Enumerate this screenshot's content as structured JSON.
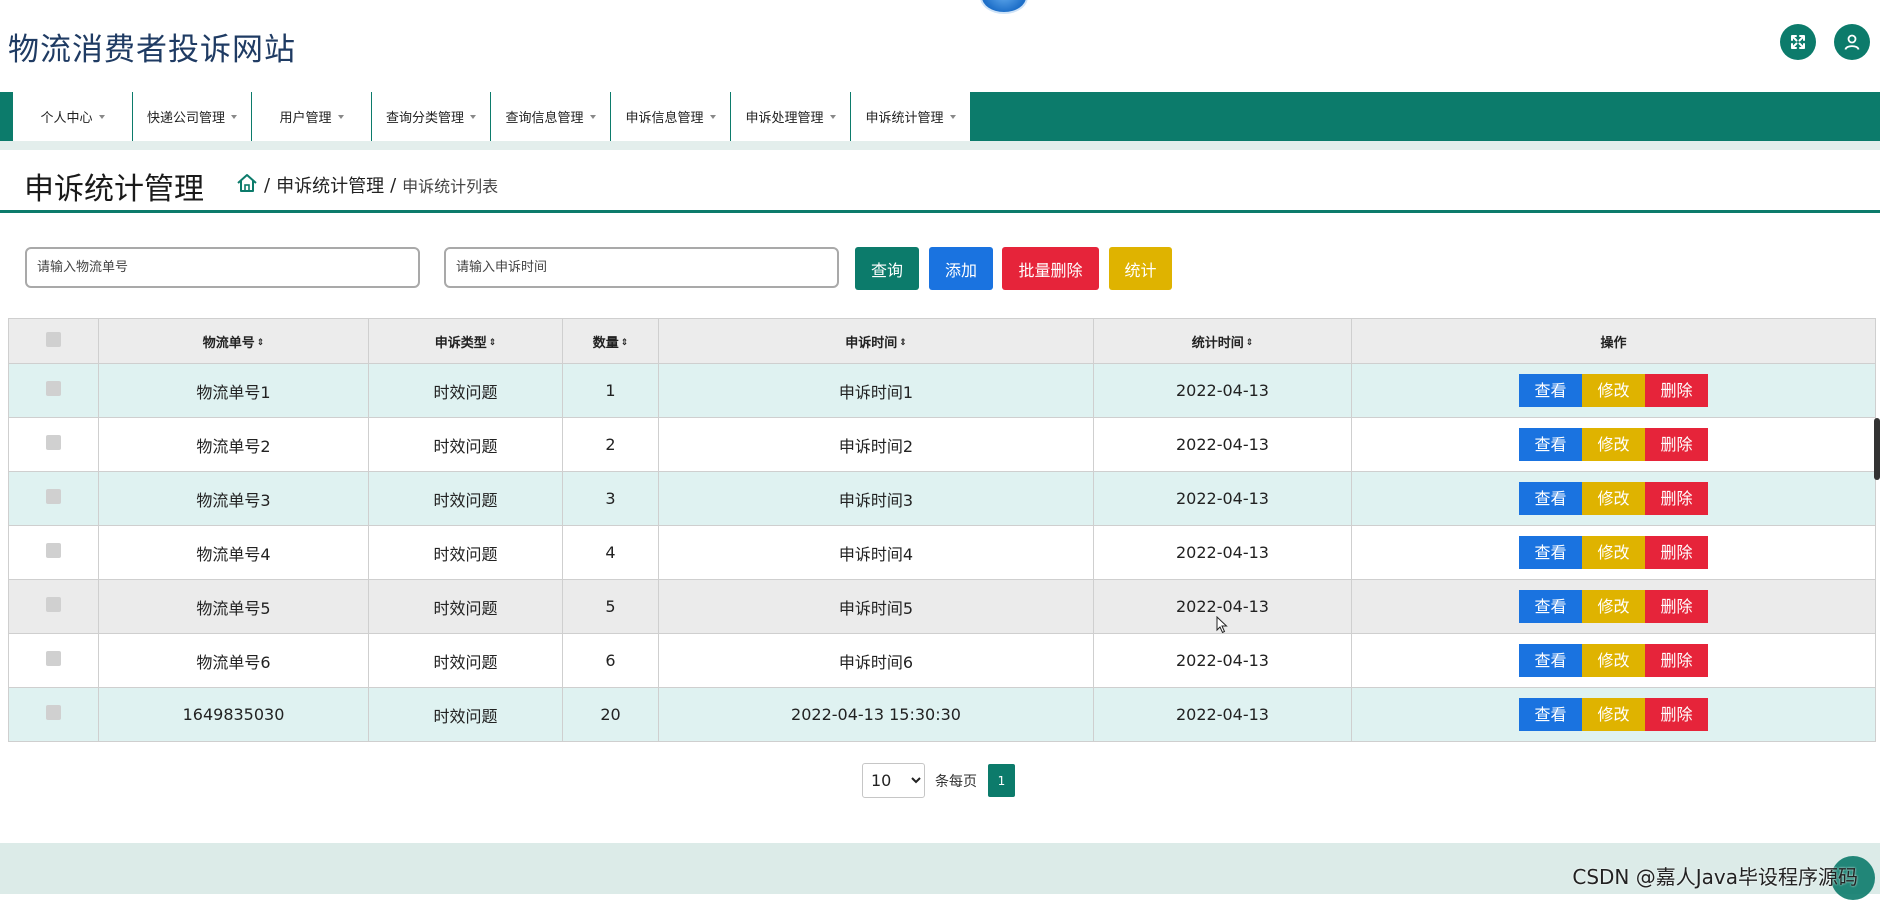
{
  "header": {
    "site_title": "物流消费者投诉网站"
  },
  "nav": {
    "items": [
      {
        "label": "个人中心"
      },
      {
        "label": "快递公司管理"
      },
      {
        "label": "用户管理"
      },
      {
        "label": "查询分类管理"
      },
      {
        "label": "查询信息管理"
      },
      {
        "label": "申诉信息管理"
      },
      {
        "label": "申诉处理管理"
      },
      {
        "label": "申诉统计管理"
      }
    ]
  },
  "page": {
    "title": "申诉统计管理",
    "breadcrumb": [
      "申诉统计管理",
      "申诉统计列表"
    ],
    "separator": "/"
  },
  "search": {
    "tracking_placeholder": "请输入物流单号",
    "time_placeholder": "请输入申诉时间",
    "query_label": "查询",
    "add_label": "添加",
    "batch_delete_label": "批量删除",
    "stats_label": "统计"
  },
  "table": {
    "columns": [
      "物流单号",
      "申诉类型",
      "数量",
      "申诉时间",
      "统计时间",
      "操作"
    ],
    "sort_icon": "⇕",
    "actions": {
      "view": "查看",
      "edit": "修改",
      "delete": "删除"
    },
    "rows": [
      {
        "tracking": "物流单号1",
        "type": "时效问题",
        "count": "1",
        "appeal_time": "申诉时间1",
        "stat_time": "2022-04-13"
      },
      {
        "tracking": "物流单号2",
        "type": "时效问题",
        "count": "2",
        "appeal_time": "申诉时间2",
        "stat_time": "2022-04-13"
      },
      {
        "tracking": "物流单号3",
        "type": "时效问题",
        "count": "3",
        "appeal_time": "申诉时间3",
        "stat_time": "2022-04-13"
      },
      {
        "tracking": "物流单号4",
        "type": "时效问题",
        "count": "4",
        "appeal_time": "申诉时间4",
        "stat_time": "2022-04-13"
      },
      {
        "tracking": "物流单号5",
        "type": "时效问题",
        "count": "5",
        "appeal_time": "申诉时间5",
        "stat_time": "2022-04-13"
      },
      {
        "tracking": "物流单号6",
        "type": "时效问题",
        "count": "6",
        "appeal_time": "申诉时间6",
        "stat_time": "2022-04-13"
      },
      {
        "tracking": "1649835030",
        "type": "时效问题",
        "count": "20",
        "appeal_time": "2022-04-13 15:30:30",
        "stat_time": "2022-04-13"
      }
    ]
  },
  "pagination": {
    "page_size": "10",
    "per_page_label": "条每页",
    "current_page": "1"
  },
  "watermark": "CSDN @嘉人Java毕设程序源码",
  "colors": {
    "primary_teal": "#0c7b6b",
    "view_blue": "#1a73e0",
    "edit_yellow": "#dfb300",
    "delete_red": "#e6243a",
    "row_alt": "#dff2f1",
    "title_navy": "#1f3b63"
  },
  "icons": {
    "fullscreen": "fullscreen-icon",
    "user": "user-icon",
    "home": "home-icon"
  }
}
